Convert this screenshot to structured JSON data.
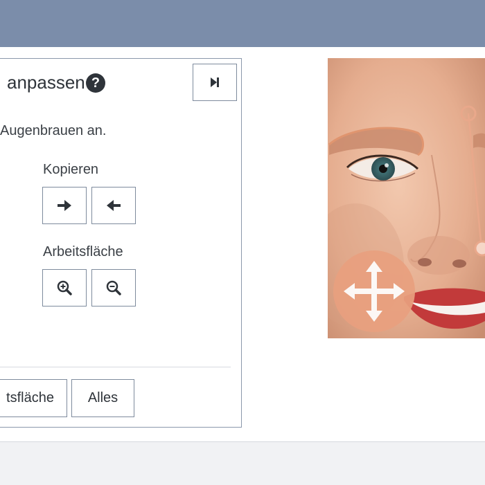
{
  "panel": {
    "title": "anpassen",
    "instruction": "Augenbrauen an.",
    "sections": {
      "copy_label": "Kopieren",
      "workspace_label": "Arbeitsfläche"
    },
    "buttons": {
      "workspace_reset_label": "tsfläche",
      "all_reset_label": "Alles"
    }
  },
  "icons": {
    "help": "question-circle-icon",
    "collapse": "skip-forward-icon",
    "copy_right": "arrow-right-icon",
    "copy_left": "arrow-left-icon",
    "zoom_in": "zoom-in-icon",
    "zoom_out": "zoom-out-icon",
    "move": "move-arrows-icon"
  },
  "colors": {
    "header": "#7b8daa",
    "border": "#7d8a9c",
    "guide_stroke": "#d9977a",
    "move_handle": "#e9a07f"
  }
}
